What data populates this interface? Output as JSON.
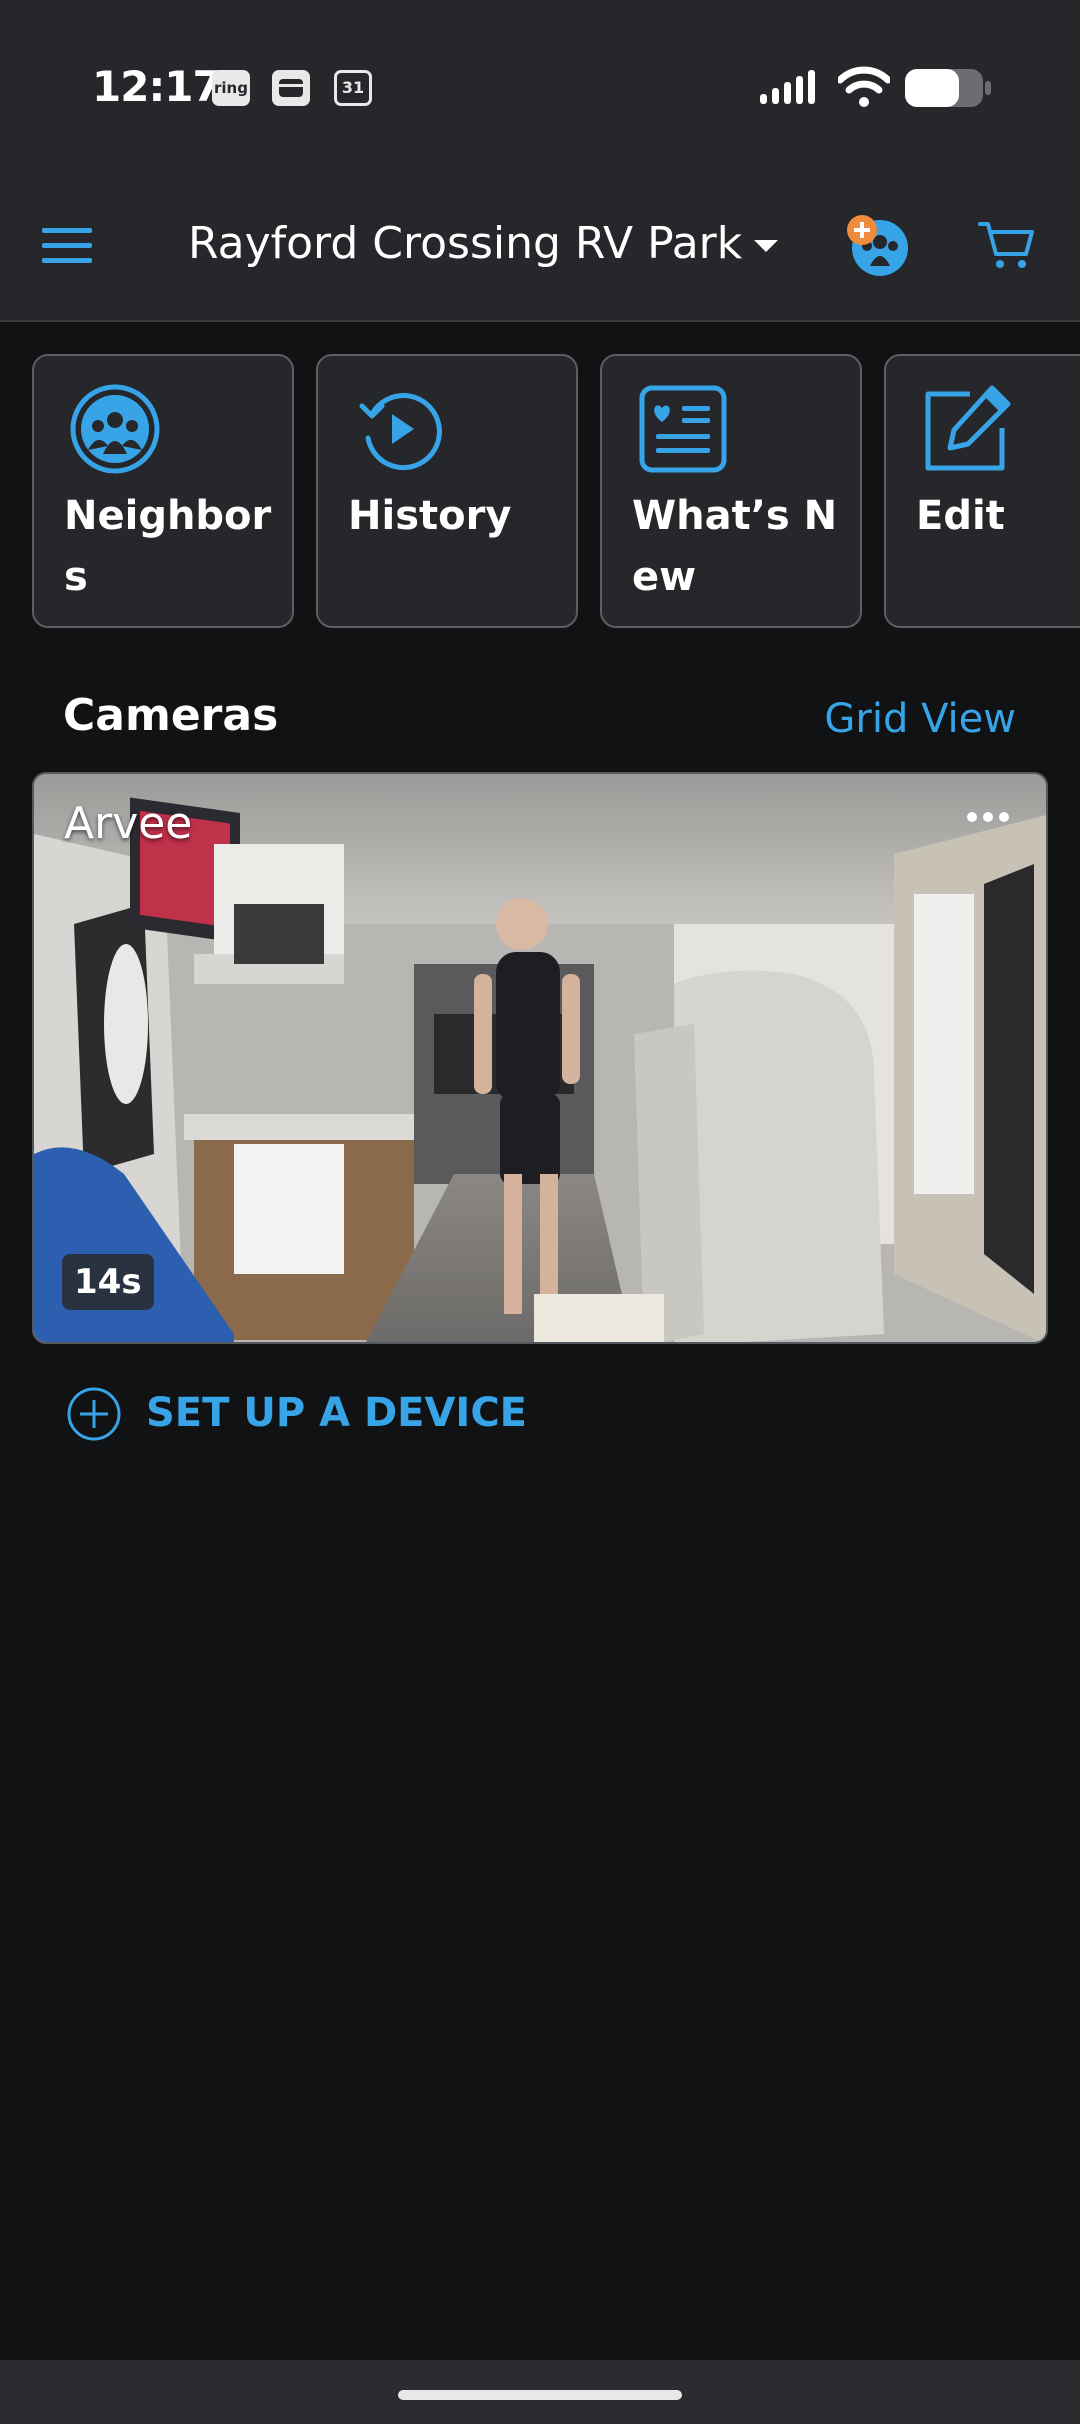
{
  "status_bar": {
    "time": "12:17",
    "notification_icons": [
      "ring",
      "wallet-icon",
      "31"
    ]
  },
  "header": {
    "location": "Rayford Crossing RV Park"
  },
  "tiles": [
    {
      "label": "Neighbor s",
      "icon": "neighbors-icon"
    },
    {
      "label": "History",
      "icon": "history-icon"
    },
    {
      "label": "What’s New",
      "icon": "whats-new-icon"
    },
    {
      "label": "Edit",
      "icon": "edit-icon"
    }
  ],
  "cameras": {
    "title": "Cameras",
    "grid_view": "Grid View",
    "items": [
      {
        "name": "Arvee",
        "duration": "14s"
      }
    ]
  },
  "setup": {
    "label": "SET UP A DEVICE"
  },
  "colors": {
    "accent": "#38a4e8",
    "header_bg": "#25272b",
    "page_bg": "#111213",
    "badge_orange": "#f08a3c"
  }
}
